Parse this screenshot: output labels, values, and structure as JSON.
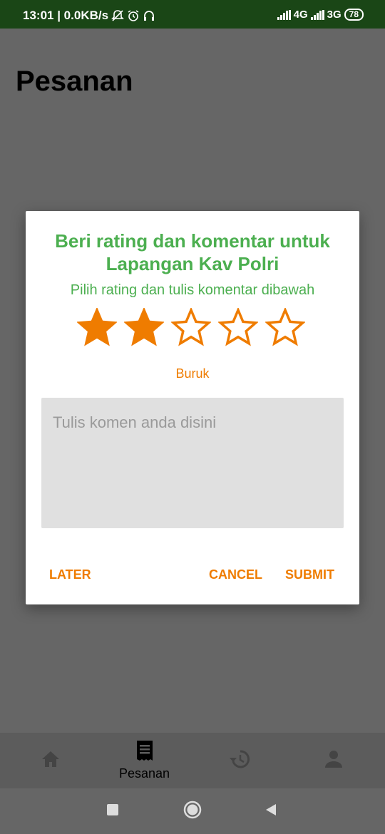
{
  "status_bar": {
    "time_speed": "13:01 | 0.0KB/s",
    "network1": "4G",
    "network2": "3G",
    "battery": "78"
  },
  "page": {
    "title": "Pesanan"
  },
  "dialog": {
    "title": "Beri rating dan komentar untuk Lapangan Kav Polri",
    "subtitle": "Pilih rating dan tulis komentar dibawah",
    "rating": 2,
    "max_rating": 5,
    "rating_label": "Buruk",
    "comment_value": "",
    "comment_placeholder": "Tulis komen anda disini",
    "later_label": "LATER",
    "cancel_label": "CANCEL",
    "submit_label": "SUBMIT",
    "accent_color": "#ef7c00",
    "title_color": "#4caf50"
  },
  "bottom_nav": {
    "items": [
      {
        "icon": "home-icon",
        "label": ""
      },
      {
        "icon": "receipt-icon",
        "label": "Pesanan"
      },
      {
        "icon": "history-icon",
        "label": ""
      },
      {
        "icon": "person-icon",
        "label": ""
      }
    ]
  }
}
